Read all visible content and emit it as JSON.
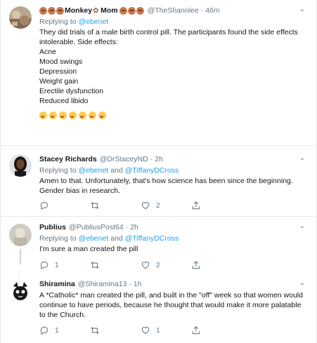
{
  "tweets": [
    {
      "name": "Monkey",
      "name_suffix": "Mom",
      "handle": "@TheShannlee",
      "time": "46m",
      "reply_prefix": "Replying to",
      "reply_to": "@ebenet",
      "reply_joiner": "",
      "reply_to2": "",
      "body": "They did trials of a male birth control pill. The participants found the side effects intolerable. Side effects:\nAcne\nMood swings\nDepression\nWeight gain\nErectile dysfunction\nReduced libido",
      "replies": "",
      "retweets": "",
      "likes": ""
    },
    {
      "name": "Stacey Richards",
      "handle": "@DrStaceyND",
      "time": "2h",
      "reply_prefix": "Replying to",
      "reply_to": "@ebenet",
      "reply_joiner": "and",
      "reply_to2": "@TiffanyDCross",
      "body": "Amen to that. Unfortunately, that's how science has been since the beginning. Gender bias in research.",
      "replies": "",
      "retweets": "",
      "likes": "2"
    },
    {
      "name": "Publius",
      "handle": "@PubliusPost64",
      "time": "2h",
      "reply_prefix": "Replying to",
      "reply_to": "@ebenet",
      "reply_joiner": "and",
      "reply_to2": "@TiffanyDCross",
      "body": "I'm sure a man created the pill",
      "replies": "1",
      "retweets": "",
      "likes": "2"
    },
    {
      "name": "Shiramina",
      "handle": "@Shiramina13",
      "time": "1h",
      "body": "A *Catholic* man created the pill, and built in the \"off\" week so that women would continue to have periods, because he thought that would make it more palatable to the Church.",
      "replies": "1",
      "retweets": "",
      "likes": "1"
    }
  ],
  "separator_dot": "·",
  "colors": {
    "accent": "#1da1f2",
    "muted": "#657786",
    "border": "#e6ecf0",
    "text": "#14171a"
  }
}
